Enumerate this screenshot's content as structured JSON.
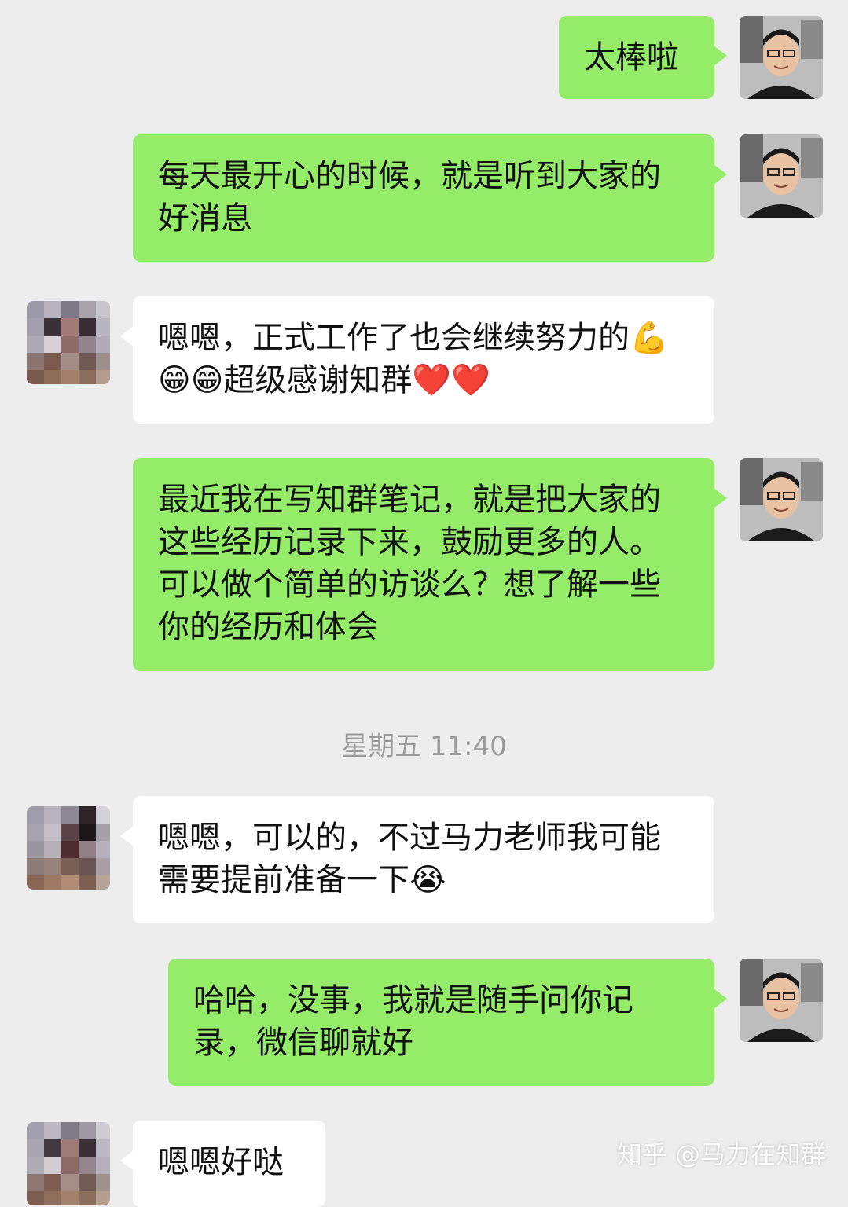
{
  "messages": [
    {
      "id": "m1",
      "side": "out",
      "text": "太棒啦"
    },
    {
      "id": "m2",
      "side": "out",
      "text": "每天最开心的时候，就是听到大家的好消息"
    },
    {
      "id": "m3",
      "side": "in",
      "text": "嗯嗯，正式工作了也会继续努力的💪😁😁超级感谢知群❤️❤️"
    },
    {
      "id": "m4",
      "side": "out",
      "text": "最近我在写知群笔记，就是把大家的这些经历记录下来，鼓励更多的人。可以做个简单的访谈么？想了解一些你的经历和体会"
    },
    {
      "id": "m5",
      "side": "in",
      "text": "嗯嗯，可以的，不过马力老师我可能需要提前准备一下😭"
    },
    {
      "id": "m6",
      "side": "out",
      "text": "哈哈，没事，我就是随手问你记录，微信聊就好"
    },
    {
      "id": "m7",
      "side": "in",
      "text": "嗯嗯好哒"
    }
  ],
  "timestamp": "星期五 11:40",
  "watermark": "知乎 @马力在知群",
  "colors": {
    "background": "#ededed",
    "outgoing": "#95ec69",
    "incoming": "#ffffff",
    "timestamp": "#9a9a9a"
  }
}
